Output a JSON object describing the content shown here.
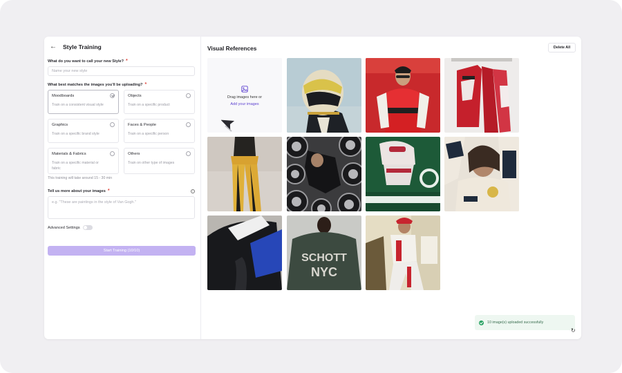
{
  "header": {
    "title": "Style Training",
    "back_icon": "arrow-left-icon"
  },
  "form": {
    "name_label": "What do you want to call your new Style?",
    "name_placeholder": "Name your new style",
    "name_value": "",
    "category_label": "What best matches the images you'll be uploading?",
    "options": [
      {
        "title": "Moodboards",
        "desc": "Train on a consistent visual style",
        "selected": true
      },
      {
        "title": "Objects",
        "desc": "Train on a specific product",
        "selected": false
      },
      {
        "title": "Graphics",
        "desc": "Train on a specific brand style",
        "selected": false
      },
      {
        "title": "Faces & People",
        "desc": "Train on a specific person",
        "selected": false
      },
      {
        "title": "Materials & Fabrics",
        "desc": "Train on a specific material or fabric",
        "selected": false
      },
      {
        "title": "Others",
        "desc": "Train on other type of images",
        "selected": false
      }
    ],
    "training_note": "This training will take around 15 - 30 min",
    "describe_label": "Tell us more about your images",
    "describe_placeholder": "e.g. \"These are paintings in the style of Van Gogh.\"",
    "advanced_label": "Advanced Settings",
    "advanced_enabled": false,
    "start_button": "Start Training (10/10)"
  },
  "references": {
    "title": "Visual References",
    "delete_all": "Delete All",
    "drop_text": "Drag images here or",
    "drop_link": "Add your images",
    "image_count": 10
  },
  "toast": {
    "message": "10 image(s) uploaded successfully"
  },
  "colors": {
    "accent": "#5b3fcf",
    "button_disabled": "#c3b2f2",
    "required": "#e0463e",
    "success": "#28a262"
  }
}
